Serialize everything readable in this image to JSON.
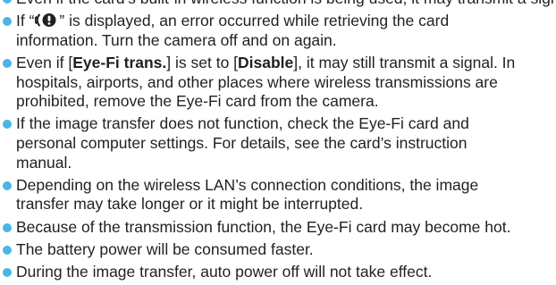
{
  "bullet_color": "#49b6e6",
  "notes": {
    "n0": {
      "l0": "Even if the card’s built-in wireless function is being used, it may transmit a signal."
    },
    "n1": {
      "l0_pre": "If “",
      "l0_icon": "error-icon",
      "l0_post": "” is displayed, an error occurred while retrieving the card",
      "l1": "information. Turn the camera off and on again."
    },
    "n2": {
      "l0_a": "Even if [",
      "l0_b": "Eye-Fi trans.",
      "l0_c": "] is set to [",
      "l0_d": "Disable",
      "l0_e": "], it may still transmit a signal. In",
      "l1": "hospitals, airports, and other places where wireless transmissions are",
      "l2": "prohibited, remove the Eye-Fi card from the camera."
    },
    "n3": {
      "l0": "If the image transfer does not function, check the Eye-Fi card and",
      "l1": "personal computer settings. For details, see the card’s instruction",
      "l2": "manual."
    },
    "n4": {
      "l0": "Depending on the wireless LAN’s connection conditions, the image",
      "l1": "transfer may take longer or it might be interrupted."
    },
    "n5": {
      "l0": "Because of the transmission function, the Eye-Fi card may become hot."
    },
    "n6": {
      "l0": "The battery power will be consumed faster."
    },
    "n7": {
      "l0": "During the image transfer, auto power off will not take effect."
    }
  }
}
